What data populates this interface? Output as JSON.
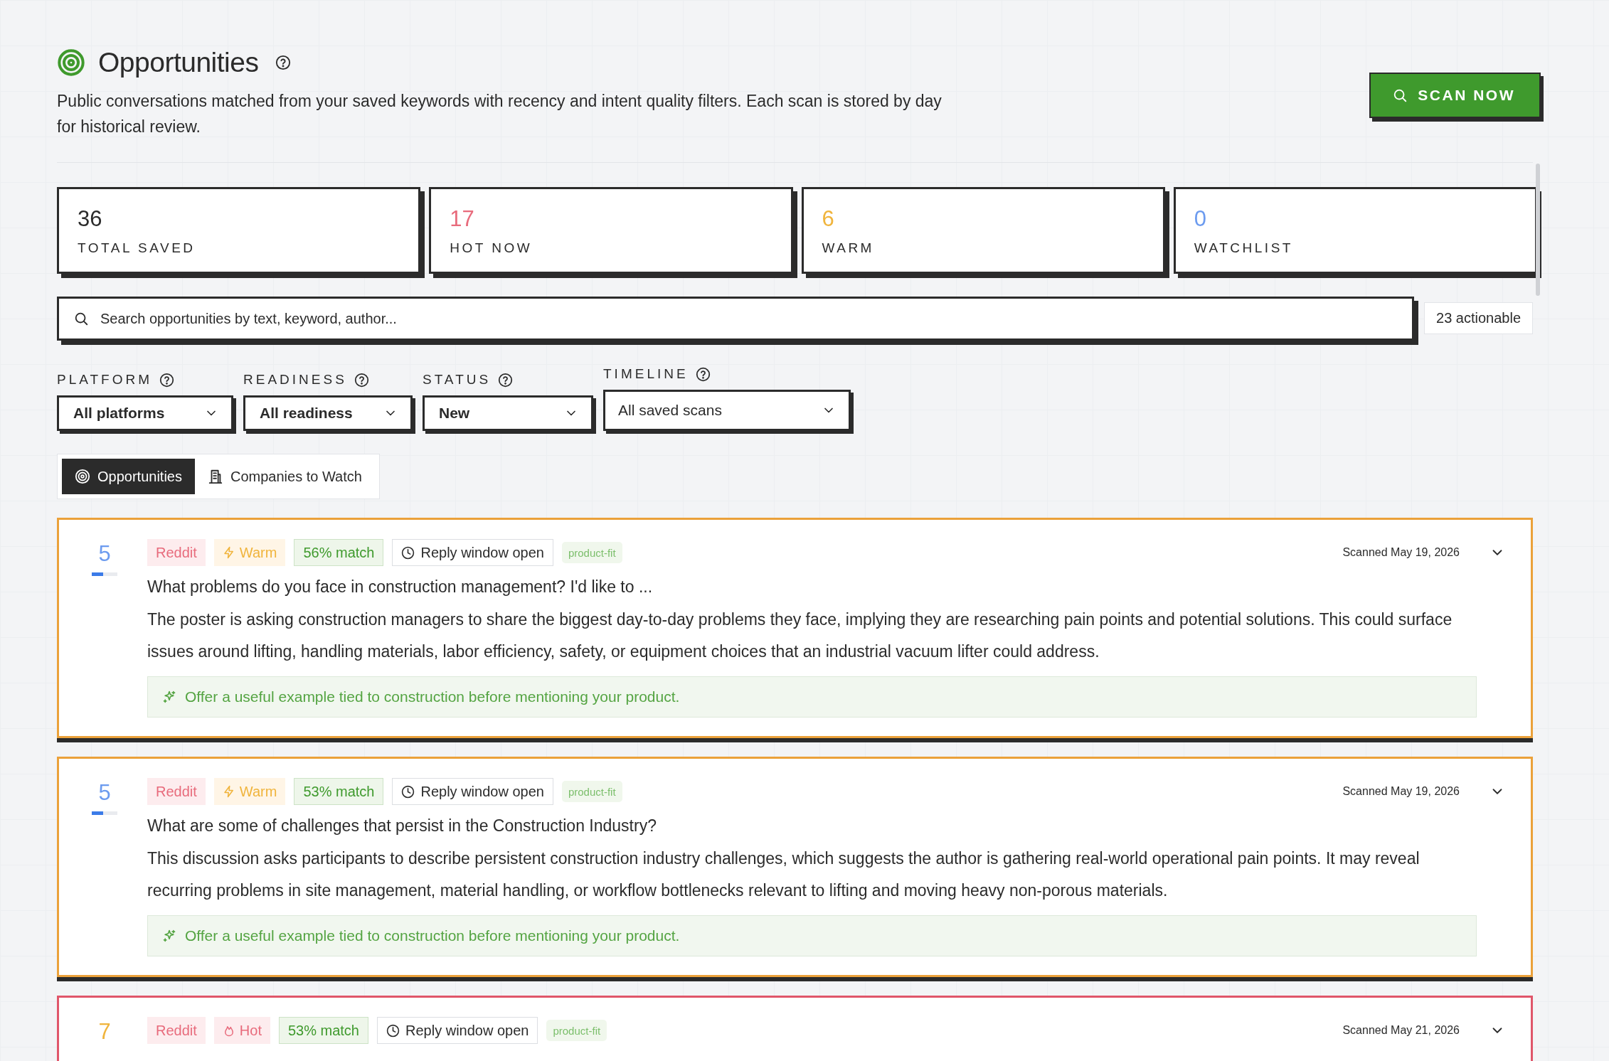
{
  "header": {
    "title": "Opportunities",
    "description": "Public conversations matched from your saved keywords with recency and intent quality filters. Each scan is stored by day for historical review.",
    "scan_button": "SCAN NOW"
  },
  "stats": [
    {
      "value": "36",
      "label": "TOTAL SAVED",
      "color": "#2b2b2b"
    },
    {
      "value": "17",
      "label": "HOT NOW",
      "color": "#e86b7c"
    },
    {
      "value": "6",
      "label": "WARM",
      "color": "#f0b43c"
    },
    {
      "value": "0",
      "label": "WATCHLIST",
      "color": "#6c9bef"
    }
  ],
  "search": {
    "placeholder": "Search opportunities by text, keyword, author...",
    "count": "23 actionable"
  },
  "filters": [
    {
      "label": "PLATFORM",
      "value": "All platforms",
      "kind": "compact"
    },
    {
      "label": "READINESS",
      "value": "All readiness",
      "kind": "compact"
    },
    {
      "label": "STATUS",
      "value": "New",
      "kind": "compact"
    },
    {
      "label": "TIMELINE",
      "value": "All saved scans",
      "kind": "wide"
    }
  ],
  "tabs": [
    {
      "label": "Opportunities",
      "selected": true
    },
    {
      "label": "Companies to Watch",
      "selected": false
    }
  ],
  "opportunities": [
    {
      "score": {
        "value": "5",
        "color": "#6c9bef",
        "level": 0.45
      },
      "platform": "Reddit",
      "readiness": {
        "kind": "warm",
        "label": "Warm"
      },
      "match": "56% match",
      "window": "Reply window open",
      "tag": "product-fit",
      "date": "Scanned May 19, 2026",
      "expanded": false,
      "title": "What problems do you face in construction management? I'd like to ...",
      "summary": "The poster is asking construction managers to share the biggest day-to-day problems they face, implying they are researching pain points and potential solutions. This could surface issues around lifting, handling materials, labor efficiency, safety, or equipment choices that an industrial vacuum lifter could address.",
      "suggestion": "Offer a useful example tied to construction before mentioning your product."
    },
    {
      "score": {
        "value": "5",
        "color": "#6c9bef",
        "level": 0.45
      },
      "platform": "Reddit",
      "readiness": {
        "kind": "warm",
        "label": "Warm"
      },
      "match": "53% match",
      "window": "Reply window open",
      "tag": "product-fit",
      "date": "Scanned May 19, 2026",
      "expanded": false,
      "title": "What are some of challenges that persist in the Construction Industry?",
      "summary": "This discussion asks participants to describe persistent construction industry challenges, which suggests the author is gathering real-world operational pain points. It may reveal recurring problems in site management, material handling, or workflow bottlenecks relevant to lifting and moving heavy non-porous materials.",
      "suggestion": "Offer a useful example tied to construction before mentioning your product."
    },
    {
      "score": {
        "value": "7",
        "color": "#f0b43c"
      },
      "platform": "Reddit",
      "readiness": {
        "kind": "hot",
        "label": "Hot"
      },
      "match": "53% match",
      "window": "Reply window open",
      "tag": "product-fit",
      "date": "Scanned May 21, 2026",
      "expanded": false
    }
  ]
}
